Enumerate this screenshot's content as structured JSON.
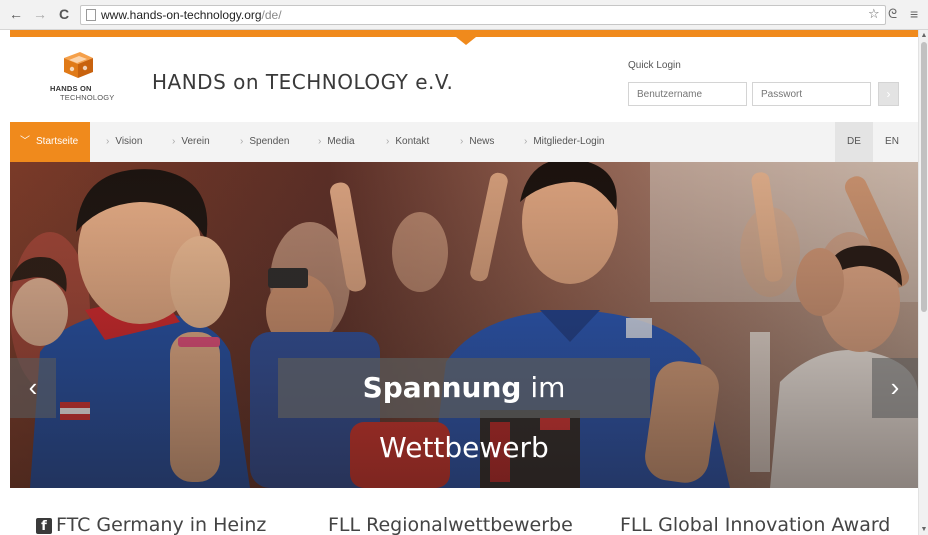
{
  "browser": {
    "url_host": "www.hands-on-technology.org",
    "url_path": "/de/",
    "back_icon": "arrow-left-icon",
    "forward_icon": "arrow-right-icon",
    "reload_icon": "reload-icon"
  },
  "header": {
    "logo_line1": "HANDS ON",
    "logo_line2": "TECHNOLOGY",
    "title": "HANDS on TECHNOLOGY e.V."
  },
  "quick_login": {
    "label": "Quick Login",
    "username_placeholder": "Benutzername",
    "password_placeholder": "Passwort",
    "submit_label": "›"
  },
  "nav": {
    "items": [
      {
        "label": "Startseite",
        "active": true
      },
      {
        "label": "Vision"
      },
      {
        "label": "Verein"
      },
      {
        "label": "Spenden"
      },
      {
        "label": "Media"
      },
      {
        "label": "Kontakt"
      },
      {
        "label": "News"
      },
      {
        "label": "Mitglieder-Login"
      }
    ],
    "languages": [
      "DE",
      "EN"
    ]
  },
  "hero": {
    "caption_bold": "Spannung",
    "caption_rest": " im Wettbewerb",
    "prev": "‹",
    "next": "›"
  },
  "teasers": [
    {
      "label": "FTC Germany in Heinz",
      "icon": "facebook-icon"
    },
    {
      "label": "FLL Regionalwettbewerbe"
    },
    {
      "label": "FLL Global Innovation Award"
    }
  ],
  "colors": {
    "accent": "#f08a1c",
    "nav_bg": "#f3f3f3"
  }
}
